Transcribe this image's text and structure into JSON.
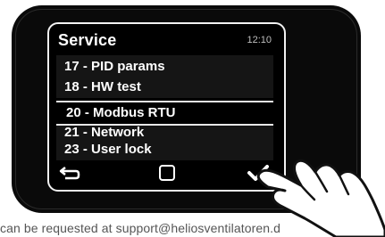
{
  "screen": {
    "title": "Service",
    "clock": "12:10"
  },
  "menu": {
    "items": [
      {
        "number": "17 -",
        "label": "PID params"
      },
      {
        "number": "18 -",
        "label": "HW test"
      },
      {
        "number": "20 -",
        "label": "Modbus RTU",
        "selected": true
      },
      {
        "number": "21 -",
        "label": "Network"
      },
      {
        "number": "23 -",
        "label": "User lock"
      }
    ]
  },
  "footer": {
    "back_icon": "back-arrow-icon",
    "home_icon": "square-icon",
    "confirm_icon": "checkmark-icon"
  },
  "caption": {
    "text": "can be requested at support@heliosventilatoren.d"
  },
  "colors": {
    "screen_bg": "#000000",
    "text": "#ffffff",
    "bezel": "#0a0a0a"
  }
}
